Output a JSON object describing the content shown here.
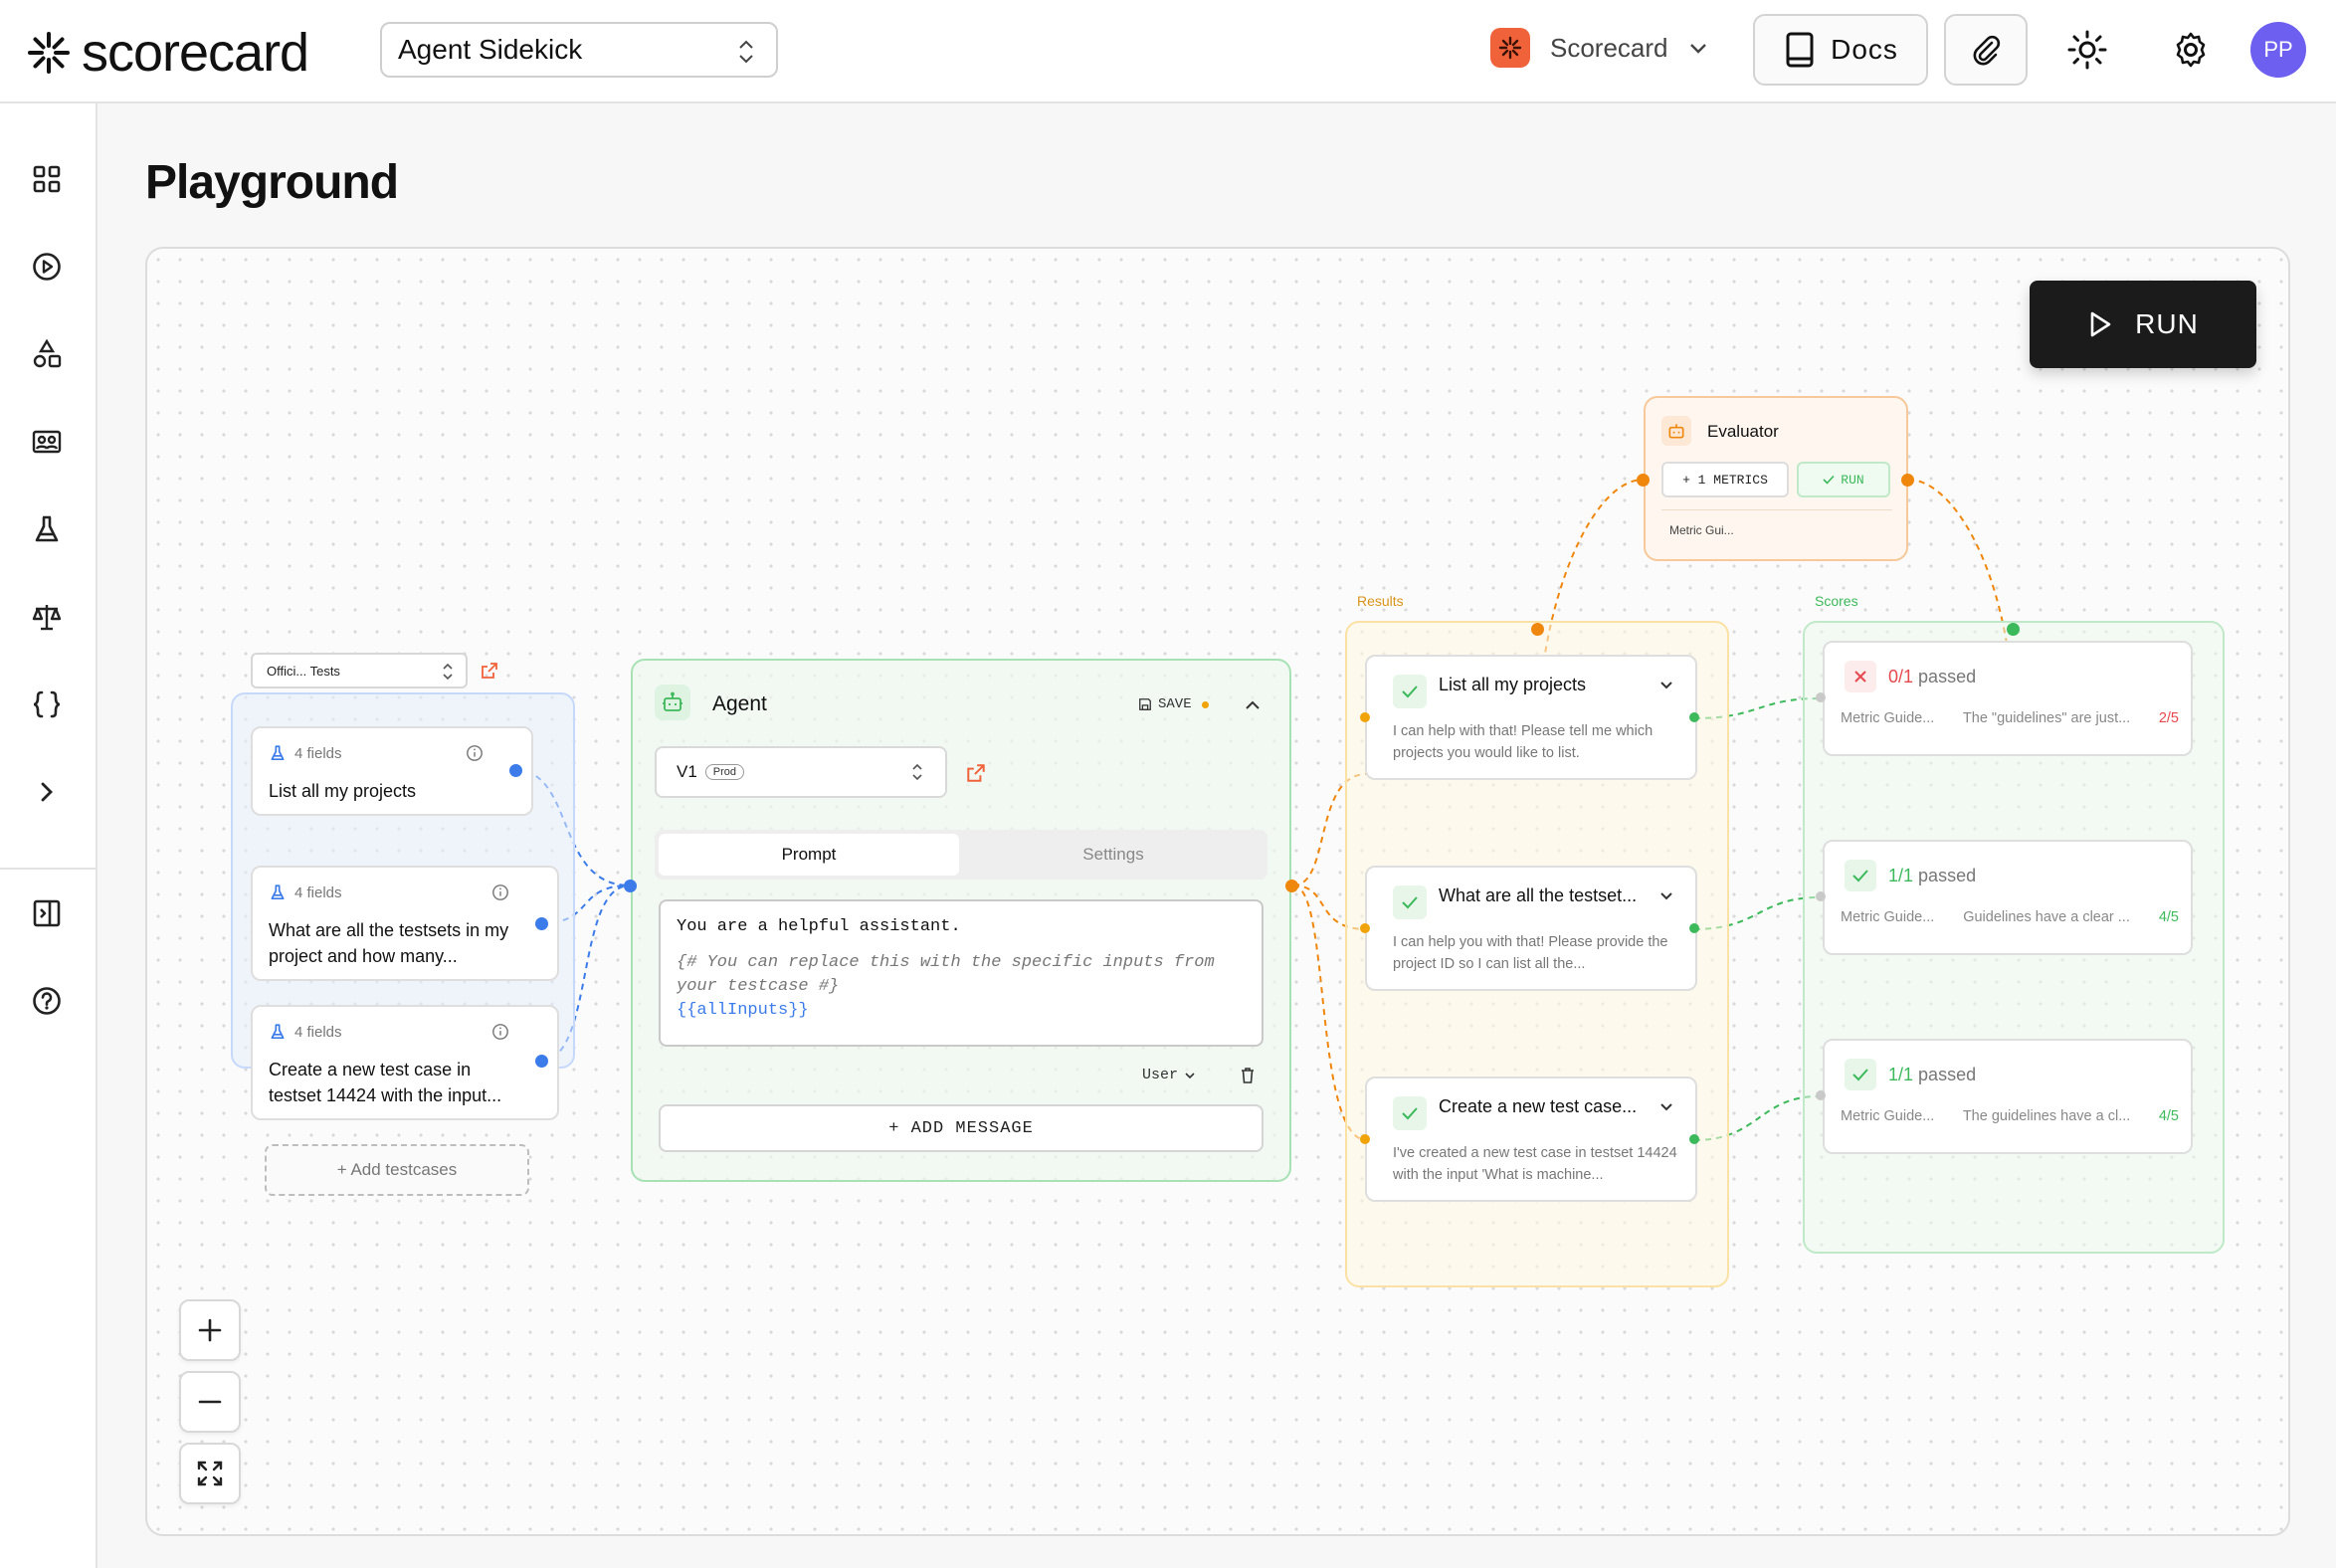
{
  "header": {
    "logo_text": "scorecard",
    "project": "Agent Sidekick",
    "org_name": "Scorecard",
    "docs_label": "Docs",
    "avatar_initials": "PP"
  },
  "page": {
    "title": "Playground"
  },
  "canvas": {
    "run_label": "RUN",
    "testset": {
      "selector": "Offici... Tests",
      "testcases": [
        {
          "fields": "4 fields",
          "text": "List all my projects"
        },
        {
          "fields": "4 fields",
          "text": "What are all the testsets in my project and how many..."
        },
        {
          "fields": "4 fields",
          "text": "Create a new test case in testset 14424 with the input..."
        }
      ],
      "add_label": "+ Add testcases"
    },
    "agent": {
      "title": "Agent",
      "save_label": "SAVE",
      "version": "V1",
      "version_tag": "Prod",
      "tabs": [
        "Prompt",
        "Settings"
      ],
      "prompt_line1": "You are a helpful assistant.",
      "prompt_comment": "{# You can replace this with the specific inputs from your testcase #}",
      "prompt_var": "{{allInputs}}",
      "role": "User",
      "add_message": "+ ADD MESSAGE"
    },
    "evaluator": {
      "title": "Evaluator",
      "metrics_btn": "+ 1 METRICS",
      "run_btn": "RUN",
      "metric_chip": "Metric Gui..."
    },
    "results": {
      "label": "Results",
      "items": [
        {
          "title": "List all my projects",
          "body": "I can help with that! Please tell me which projects you would like to list."
        },
        {
          "title": "What are all the testset...",
          "body": "I can help you with that! Please provide the project ID so I can list all the..."
        },
        {
          "title": "Create a new test case...",
          "body": "I've created a new test case in testset 14424 with the input 'What is machine..."
        }
      ]
    },
    "scores": {
      "label": "Scores",
      "items": [
        {
          "frac": "0/1",
          "passed": "passed",
          "metric": "Metric Guide...",
          "desc": "The \"guidelines\" are just...",
          "score": "2/5",
          "status": "fail"
        },
        {
          "frac": "1/1",
          "passed": "passed",
          "metric": "Metric Guide...",
          "desc": "Guidelines have a clear ...",
          "score": "4/5",
          "status": "pass"
        },
        {
          "frac": "1/1",
          "passed": "passed",
          "metric": "Metric Guide...",
          "desc": "The guidelines have a cl...",
          "score": "4/5",
          "status": "pass"
        }
      ]
    }
  },
  "colors": {
    "blue": "#3b7bea",
    "green": "#3cb95a",
    "orange": "#f0870d",
    "red": "#e5484d"
  }
}
